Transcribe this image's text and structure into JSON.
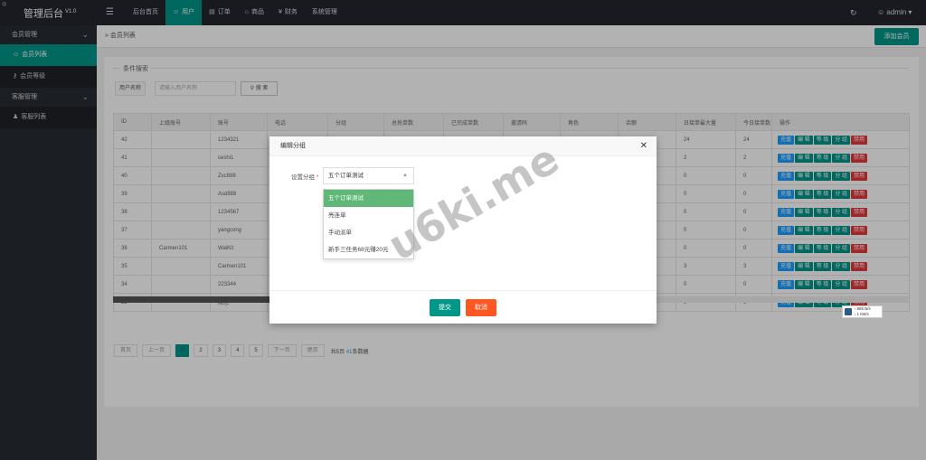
{
  "brand": {
    "title": "管理后台",
    "version": "V1.0"
  },
  "header": {
    "nav": [
      {
        "label": "后台首页",
        "icon": "",
        "active": false
      },
      {
        "label": "用户",
        "icon": "user-icon",
        "active": true
      },
      {
        "label": "订单",
        "icon": "document-icon",
        "active": false
      },
      {
        "label": "商品",
        "icon": "cart-icon",
        "active": false
      },
      {
        "label": "财务",
        "icon": "yen-icon",
        "active": false
      },
      {
        "label": "系统管理",
        "icon": "",
        "active": false
      }
    ],
    "user": "admin"
  },
  "sidebar": {
    "member_group": "会员管理",
    "member_list": "会员列表",
    "member_level": "会员等级",
    "service_group": "客服管理",
    "service_list": "客服列表"
  },
  "breadcrumb": "会员列表",
  "add_button": "添加会员",
  "search": {
    "legend": "条件搜索",
    "label": "用户名称",
    "placeholder": "请输入用户名称",
    "button": "搜 索"
  },
  "table": {
    "columns": [
      "ID",
      "上级账号",
      "账号",
      "电话",
      "分组",
      "总抢单数",
      "已完成单数",
      "邀请码",
      "角色",
      "余额",
      "日接单最大量",
      "今日接单数",
      "操作"
    ],
    "rows": [
      [
        "42",
        "",
        "1234321",
        "",
        "",
        "",
        "",
        "",
        "",
        "",
        "24",
        "24"
      ],
      [
        "41",
        "",
        "ceshi1",
        "",
        "",
        "",
        "",
        "",
        "",
        "",
        "2",
        "2"
      ],
      [
        "40",
        "",
        "Zxc888",
        "",
        "",
        "",
        "",
        "",
        "",
        "",
        "0",
        "0"
      ],
      [
        "39",
        "",
        "Asd888",
        "",
        "",
        "",
        "",
        "",
        "",
        "",
        "0",
        "0"
      ],
      [
        "38",
        "",
        "1234567",
        "",
        "",
        "",
        "",
        "",
        "",
        "",
        "0",
        "0"
      ],
      [
        "37",
        "",
        "yangcong",
        "",
        "",
        "",
        "",
        "",
        "",
        "",
        "0",
        "0"
      ],
      [
        "36",
        "Carmen101",
        "WaiKit",
        "",
        "",
        "",
        "",
        "",
        "",
        "",
        "0",
        "0"
      ],
      [
        "35",
        "",
        "Carmen101",
        "",
        "",
        "",
        "",
        "",
        "",
        "",
        "3",
        "3"
      ],
      [
        "34",
        "",
        "223344",
        "",
        "",
        "",
        "",
        "",
        "",
        "",
        "0",
        "0"
      ],
      [
        "33",
        "",
        "席总",
        "",
        "",
        "",
        "",
        "",
        "",
        "",
        "0",
        "0"
      ]
    ],
    "actions": [
      "充值",
      "编 辑",
      "等 级",
      "分 组",
      "禁用"
    ]
  },
  "pager": {
    "first": "首页",
    "prev": "上一页",
    "pages": [
      "1",
      "2",
      "3",
      "4",
      "5"
    ],
    "next": "下一页",
    "last": "尾页",
    "info_prefix": "共5页",
    "info_count": "41",
    "info_suffix": "条数据"
  },
  "modal": {
    "title": "编辑分组",
    "field_label": "设置分组",
    "selected": "五个订单测试",
    "options": [
      "五个订单测试",
      "亮连单",
      "手动派单",
      "新手三任务68元赚20元"
    ],
    "submit": "提交",
    "cancel": "取消"
  },
  "watermark": "u6ki.me",
  "speed": {
    "up": "865 B/s",
    "down": "1 KB/s"
  },
  "colors": {
    "primary": "#009688",
    "blue": "#1e9fff",
    "red": "#e5393b",
    "orange": "#ff5722",
    "option_selected": "#5fb878"
  }
}
